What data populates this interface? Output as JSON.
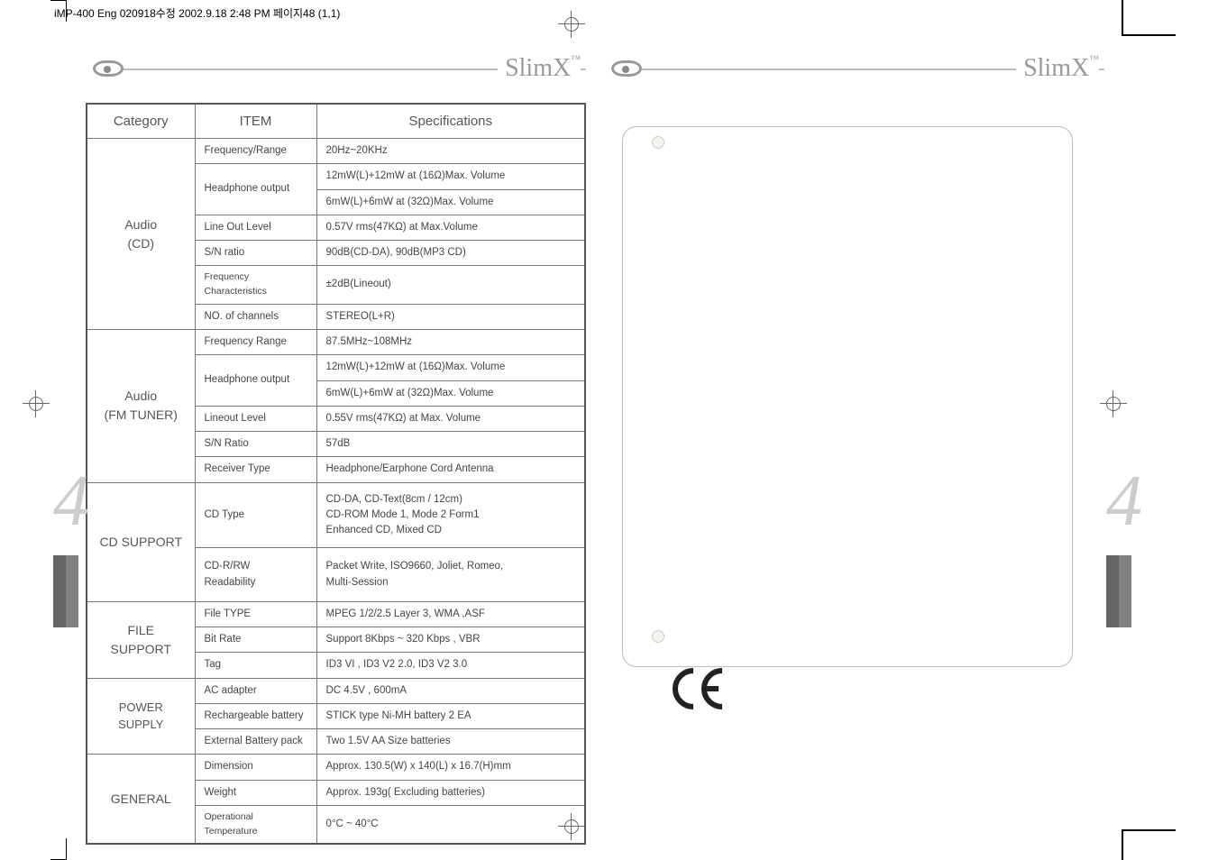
{
  "doc_header": "iMP-400 Eng 020918수정  2002.9.18 2:48 PM 페이지48 (1,1)",
  "brand": {
    "logo": "SlimX",
    "tm": "™"
  },
  "side_tab": {
    "number": "4"
  },
  "right_page": {
    "ce": "CE"
  },
  "table": {
    "headers": {
      "category": "Category",
      "item": "ITEM",
      "spec": "Specifications"
    },
    "groups": [
      {
        "category": "Audio\n(CD)",
        "rows": [
          {
            "item": "Frequency/Range",
            "spec": "20Hz~20KHz"
          },
          {
            "item": "Headphone output",
            "spec": "12mW(L)+12mW at (16Ω)Max. Volume"
          },
          {
            "item": "",
            "spec": "6mW(L)+6mW at (32Ω)Max. Volume"
          },
          {
            "item": "Line Out Level",
            "spec": "0.57V rms(47KΩ) at Max.Volume"
          },
          {
            "item": "S/N ratio",
            "spec": "90dB(CD-DA), 90dB(MP3 CD)"
          },
          {
            "item": "Frequency Characteristics",
            "spec": "±2dB(Lineout)"
          },
          {
            "item": "NO. of channels",
            "spec": "STEREO(L+R)"
          }
        ]
      },
      {
        "category": "Audio\n(FM TUNER)",
        "rows": [
          {
            "item": "Frequency Range",
            "spec": "87.5MHz~108MHz"
          },
          {
            "item": "Headphone output",
            "spec": "12mW(L)+12mW at (16Ω)Max. Volume"
          },
          {
            "item": "",
            "spec": "6mW(L)+6mW at (32Ω)Max. Volume"
          },
          {
            "item": "Lineout Level",
            "spec": "0.55V rms(47KΩ) at Max. Volume"
          },
          {
            "item": "S/N Ratio",
            "spec": "57dB"
          },
          {
            "item": "Receiver Type",
            "spec": "Headphone/Earphone Cord Antenna"
          }
        ]
      },
      {
        "category": "CD SUPPORT",
        "rows": [
          {
            "item": "CD Type",
            "spec": "CD-DA, CD-Text(8cm / 12cm)\nCD-ROM Mode 1, Mode 2 Form1\nEnhanced CD, Mixed CD"
          },
          {
            "item": "CD-R/RW\nReadability",
            "spec": "Packet Write, ISO9660, Joliet, Romeo,\nMulti-Session"
          }
        ]
      },
      {
        "category": "FILE SUPPORT",
        "rows": [
          {
            "item": "File TYPE",
            "spec": "MPEG 1/2/2.5 Layer 3, WMA ,ASF"
          },
          {
            "item": "Bit Rate",
            "spec": "Support 8Kbps ~ 320 Kbps , VBR"
          },
          {
            "item": "Tag",
            "spec": "ID3 VI , ID3 V2 2.0, ID3 V2 3.0"
          }
        ]
      },
      {
        "category": "POWER SUPPLY",
        "rows": [
          {
            "item": "AC adapter",
            "spec": "DC 4.5V , 600mA"
          },
          {
            "item": "Rechargeable battery",
            "spec": "STICK type Ni-MH battery 2 EA"
          },
          {
            "item": "External Battery pack",
            "spec": "Two 1.5V AA Size batteries"
          }
        ]
      },
      {
        "category": "GENERAL",
        "rows": [
          {
            "item": "Dimension",
            "spec": "Approx. 130.5(W) x 140(L) x 16.7(H)mm"
          },
          {
            "item": "Weight",
            "spec": "Approx. 193g( Excluding batteries)"
          },
          {
            "item": "Operational Temperature",
            "spec": "0°C ~ 40°C"
          }
        ]
      }
    ]
  }
}
